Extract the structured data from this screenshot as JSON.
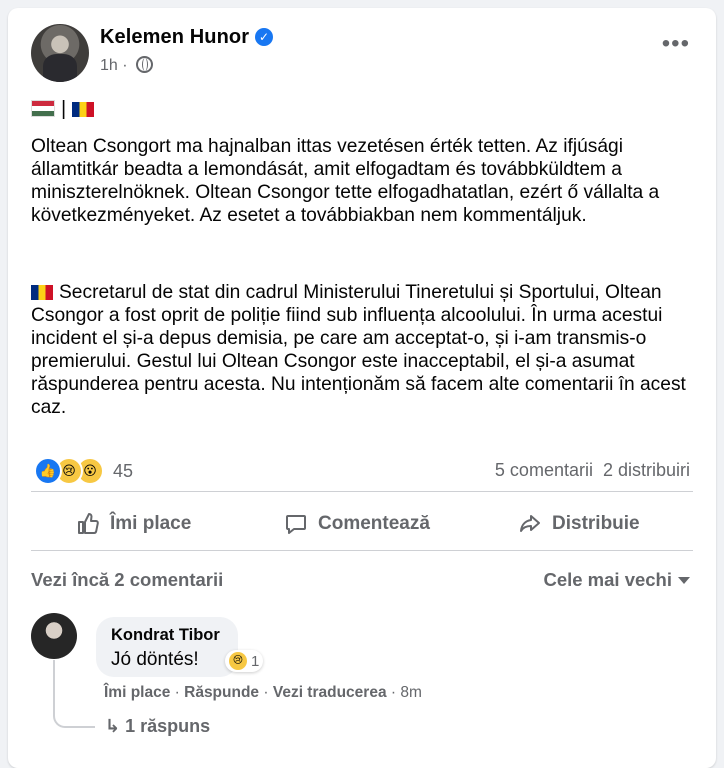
{
  "post": {
    "author": "Kelemen Hunor",
    "time": "1h",
    "privacy_icon": "globe-icon",
    "flags_separator": "|",
    "hu_text": "Oltean Csongort ma hajnalban ittas vezetésen érték tetten. Az ifjúsági államtitkár beadta a lemondását, amit elfogadtam és továbbküldtem a miniszterelnöknek. Oltean Csongor tette elfogadhatatlan, ezért ő vállalta a következményeket. Az esetet a továbbiakban nem kommentáljuk.",
    "ro_text": "Secretarul de stat din cadrul Ministerului Tineretului și Sportului, Oltean Csongor a fost oprit de poliție fiind sub influența alcoolului. În urma acestui incident el și-a depus demisia, pe care am acceptat-o, și i-am transmis-o premierului. Gestul lui Oltean Csongor este inacceptabil, el și-a asumat răspunderea pentru acesta. Nu intenționăm să facem alte comentarii în acest caz."
  },
  "stats": {
    "reaction_count": "45",
    "comments": "5 comentarii",
    "shares": "2 distribuiri"
  },
  "actions": {
    "like": "Îmi place",
    "comment": "Comentează",
    "share": "Distribuie"
  },
  "comments": {
    "more": "Vezi încă 2 comentarii",
    "sort": "Cele mai vechi",
    "items": [
      {
        "author": "Kondrat Tibor",
        "text": "Jó döntés!",
        "reaction_count": "1",
        "like": "Îmi place",
        "reply": "Răspunde",
        "translate": "Vezi traducerea",
        "time": "8m",
        "replies": "1 răspuns"
      }
    ]
  },
  "colors": {
    "accent": "#1877f2",
    "secondary_text": "#65676b",
    "background": "#f0f2f5"
  }
}
